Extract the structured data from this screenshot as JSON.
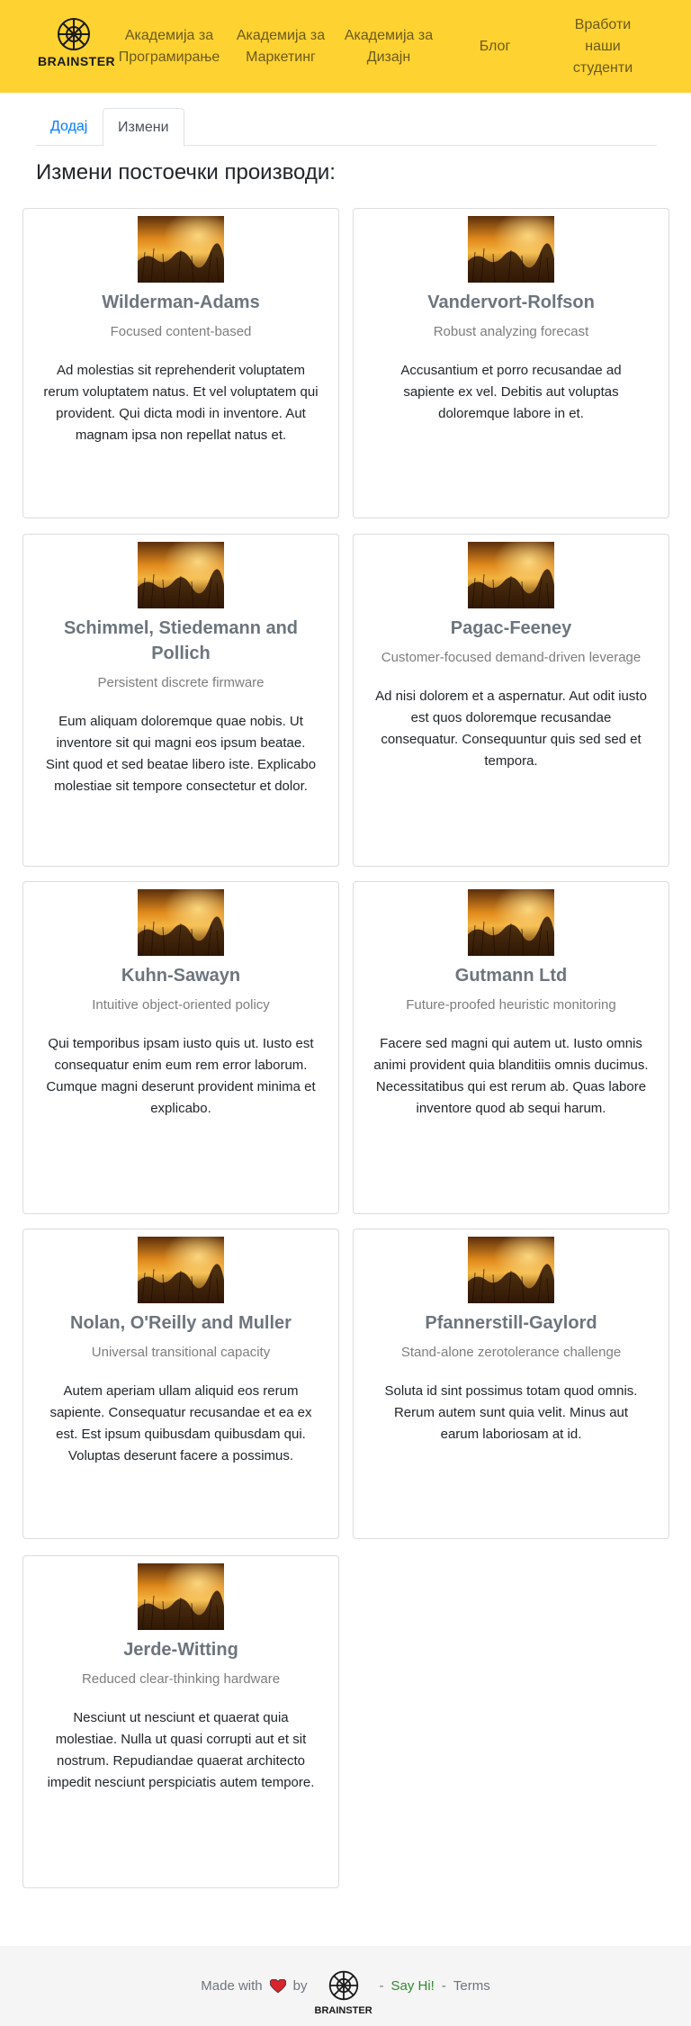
{
  "header": {
    "logo_text": "BRAINSTER",
    "nav": [
      {
        "line1": "Академија за",
        "line2": "Програмирање"
      },
      {
        "line1": "Академија за",
        "line2": "Маркетинг"
      },
      {
        "line1": "Академија за",
        "line2": "Дизајн"
      },
      {
        "line1": "Блог",
        "line2": ""
      },
      {
        "line1": "Вработи",
        "line2": "наши",
        "line3": "студенти"
      }
    ]
  },
  "tabs": {
    "add": "Додај",
    "edit": "Измени"
  },
  "page_title": "Измени постоечки производи:",
  "cards": [
    {
      "title": "Wilderman-Adams",
      "subtitle": "Focused content-based",
      "text": "Ad molestias sit reprehenderit voluptatem rerum voluptatem natus. Et vel voluptatem qui provident. Qui dicta modi in inventore. Aut magnam ipsa non repellat natus et."
    },
    {
      "title": "Vandervort-Rolfson",
      "subtitle": "Robust analyzing forecast",
      "text": "Accusantium et porro recusandae ad sapiente ex vel. Debitis aut voluptas doloremque labore in et."
    },
    {
      "title": "Schimmel, Stiedemann and Pollich",
      "subtitle": "Persistent discrete firmware",
      "text": "Eum aliquam doloremque quae nobis. Ut inventore sit qui magni eos ipsum beatae. Sint quod et sed beatae libero iste. Explicabo molestiae sit tempore consectetur et dolor."
    },
    {
      "title": "Pagac-Feeney",
      "subtitle": "Customer-focused demand-driven leverage",
      "text": "Ad nisi dolorem et a aspernatur. Aut odit iusto est quos doloremque recusandae consequatur. Consequuntur quis sed sed et tempora."
    },
    {
      "title": "Kuhn-Sawayn",
      "subtitle": "Intuitive object-oriented policy",
      "text": "Qui temporibus ipsam iusto quis ut. Iusto est consequatur enim eum rem error laborum. Cumque magni deserunt provident minima et explicabo."
    },
    {
      "title": "Gutmann Ltd",
      "subtitle": "Future-proofed heuristic monitoring",
      "text": "Facere sed magni qui autem ut. Iusto omnis animi provident quia blanditiis omnis ducimus. Necessitatibus qui est rerum ab. Quas labore inventore quod ab sequi harum."
    },
    {
      "title": "Nolan, O'Reilly and Muller",
      "subtitle": "Universal transitional capacity",
      "text": "Autem aperiam ullam aliquid eos rerum sapiente. Consequatur recusandae et ea ex est. Est ipsum quibusdam quibusdam qui. Voluptas deserunt facere a possimus."
    },
    {
      "title": "Pfannerstill-Gaylord",
      "subtitle": "Stand-alone zerotolerance challenge",
      "text": "Soluta id sint possimus totam quod omnis. Rerum autem sunt quia velit. Minus aut earum laboriosam at id."
    },
    {
      "title": "Jerde-Witting",
      "subtitle": "Reduced clear-thinking hardware",
      "text": "Nesciunt ut nesciunt et quaerat quia molestiae. Nulla ut quasi corrupti aut et sit nostrum. Repudiandae quaerat architecto impedit nesciunt perspiciatis autem tempore."
    }
  ],
  "footer": {
    "made_with": "Made with",
    "by": "by",
    "logo_text": "BRAINSTER",
    "sep1": "-",
    "say_hi": "Say Hi!",
    "sep2": "-",
    "terms": "Terms",
    "heart_icon": "heart-icon"
  }
}
